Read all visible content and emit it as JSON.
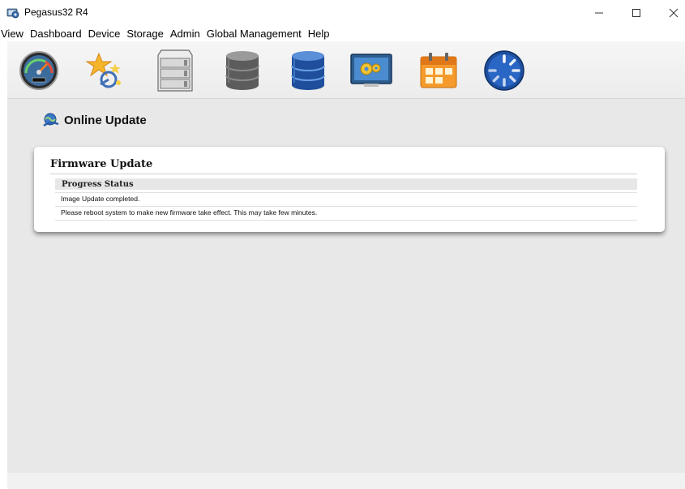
{
  "window": {
    "title": "Pegasus32 R4",
    "icon": "app-monitor-icon"
  },
  "menu": {
    "items": [
      "View",
      "Dashboard",
      "Device",
      "Storage",
      "Admin",
      "Global Management",
      "Help"
    ]
  },
  "toolbar": {
    "icons": [
      "gauge-icon",
      "wizard-stars-icon",
      "drive-enclosure-icon",
      "disk-stack-gray-icon",
      "disk-stack-blue-icon",
      "monitor-gears-icon",
      "calendar-icon",
      "spinner-icon"
    ]
  },
  "page": {
    "title": "Online Update",
    "title_icon": "online-update-icon"
  },
  "panel": {
    "title": "Firmware Update",
    "status_header": "Progress Status",
    "messages": [
      "Image Update completed.",
      "Please reboot system to make new firmware take effect. This may take few minutes."
    ]
  }
}
